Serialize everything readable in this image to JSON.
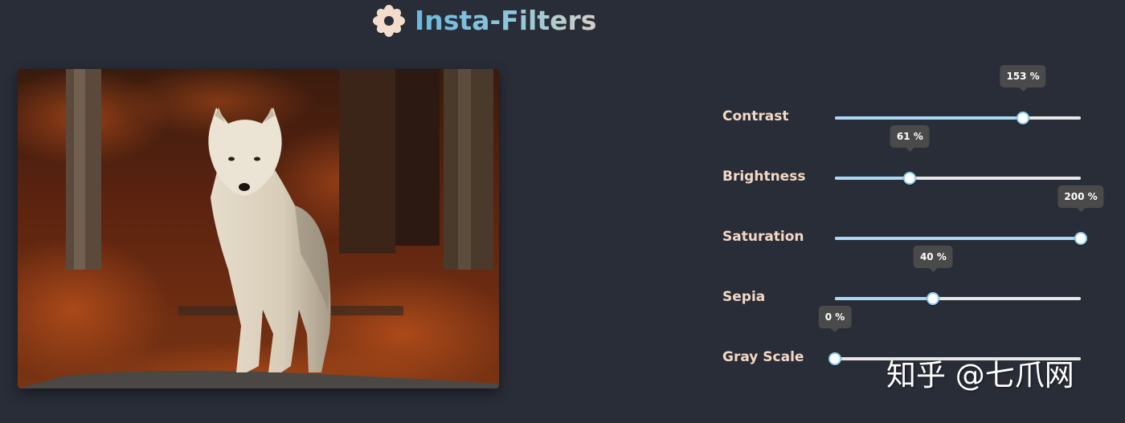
{
  "app": {
    "title": "Insta-Filters",
    "logo_icon": "flower-icon",
    "title_gradient": [
      "#6ab8df",
      "#d6cfc4"
    ]
  },
  "photo": {
    "subject": "white wolf standing on autumn forest floor"
  },
  "filters": [
    {
      "label": "Contrast",
      "value": 153,
      "min": 0,
      "max": 200,
      "display": "153 %"
    },
    {
      "label": "Brightness",
      "value": 61,
      "min": 0,
      "max": 200,
      "display": "61 %"
    },
    {
      "label": "Saturation",
      "value": 200,
      "min": 0,
      "max": 200,
      "display": "200 %"
    },
    {
      "label": "Sepia",
      "value": 40,
      "min": 0,
      "max": 100,
      "display": "40 %"
    },
    {
      "label": "Gray Scale",
      "value": 0,
      "min": 0,
      "max": 100,
      "display": "0 %"
    }
  ],
  "watermark": "知乎 @七爪网",
  "colors": {
    "background": "#292d37",
    "label": "#f3d9c5",
    "slider_fill": "#a9d9f6",
    "slider_track": "#e7e7e7",
    "tooltip": "#4a4a4a"
  }
}
